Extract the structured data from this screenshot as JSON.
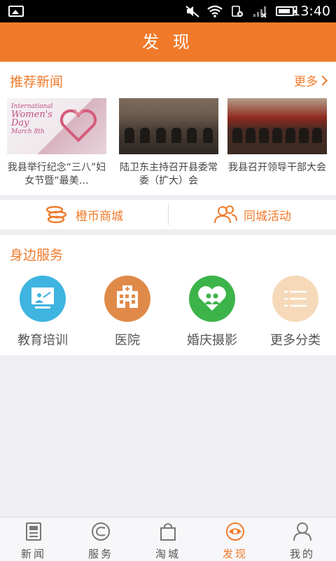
{
  "status_bar": {
    "time": "13:40"
  },
  "header": {
    "title": "发 现"
  },
  "news": {
    "section_title": "推荐新闻",
    "more_label": "更多",
    "items": [
      {
        "caption": "我县举行纪念“三八”妇女节暨“最美…",
        "thumb_text_1": "International",
        "thumb_text_2": "Women's",
        "thumb_text_3": "Day",
        "thumb_text_4": "March 8th"
      },
      {
        "caption": "陆卫东主持召开县委常委（扩大）会"
      },
      {
        "caption": "我县召开领导干部大会"
      }
    ]
  },
  "quick_links": {
    "mall_label": "橙币商城",
    "activity_label": "同城活动"
  },
  "services": {
    "section_title": "身边服务",
    "items": [
      {
        "label": "教育培训",
        "color": "#3fb4e0"
      },
      {
        "label": "医院",
        "color": "#e08a4a"
      },
      {
        "label": "婚庆摄影",
        "color": "#3db44a"
      },
      {
        "label": "更多分类",
        "color": "#f5d9b8"
      }
    ]
  },
  "bottom_nav": {
    "tabs": [
      {
        "label": "新闻",
        "icon": "newspaper-icon"
      },
      {
        "label": "服务",
        "icon": "service-icon"
      },
      {
        "label": "淘城",
        "icon": "shopping-bag-icon"
      },
      {
        "label": "发现",
        "icon": "eye-icon",
        "active": true
      },
      {
        "label": "我的",
        "icon": "user-icon"
      }
    ]
  },
  "colors": {
    "accent": "#f07a2a",
    "background": "#efeef3"
  }
}
